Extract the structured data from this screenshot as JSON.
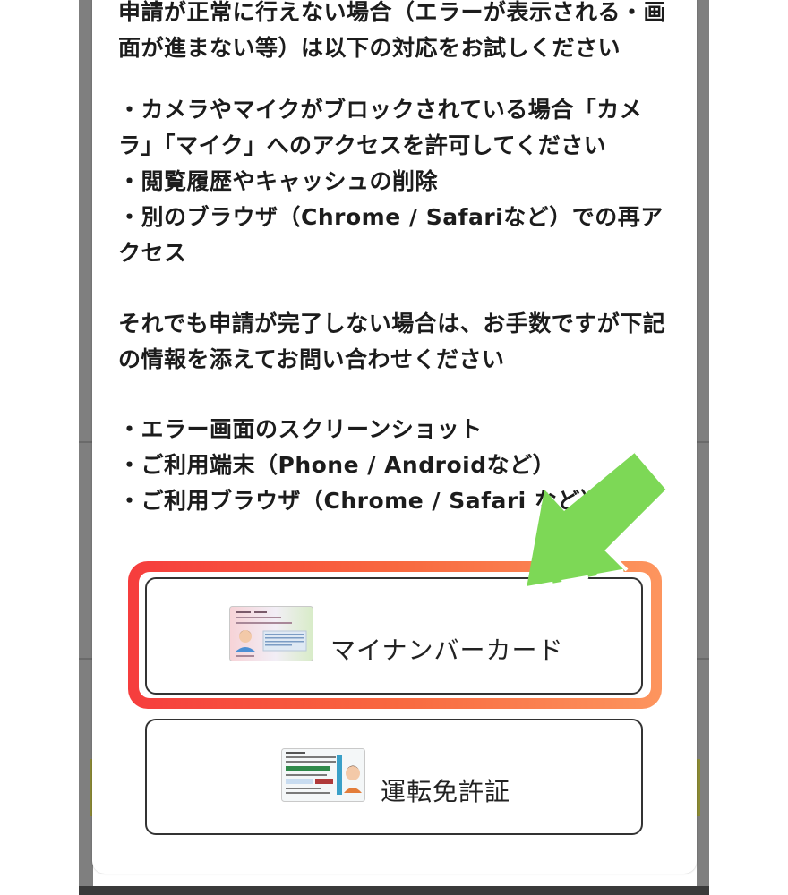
{
  "instructions": {
    "intro": "申請が正常に行えない場合（エラーが表示される・画\n面が進まない等）は以下の対応をお試しください",
    "fixes": "・カメラやマイクがブロックされている場合「カメ\nラ」「マイク」へのアクセスを許可してください\n・閲覧履歴やキャッシュの削除\n・別のブラウザ（Chrome / Safariなど）での再ア\nクセス",
    "contact_intro": "それでも申請が完了しない場合は、お手数ですが下記\nの情報を添えてお問い合わせください",
    "contact_items": "・エラー画面のスクリーンショット\n・ご利用端末（Phone / Androidなど）\n・ご利用ブラウザ（Chrome / Safari など）"
  },
  "options": [
    {
      "label": "マイナンバーカード",
      "icon": "my-number-card-icon"
    },
    {
      "label": "運転免許証",
      "icon": "drivers-license-icon"
    }
  ],
  "colors": {
    "highlight_start": "#f63d3d",
    "highlight_end": "#fd955e",
    "arrow": "#7dd856"
  }
}
